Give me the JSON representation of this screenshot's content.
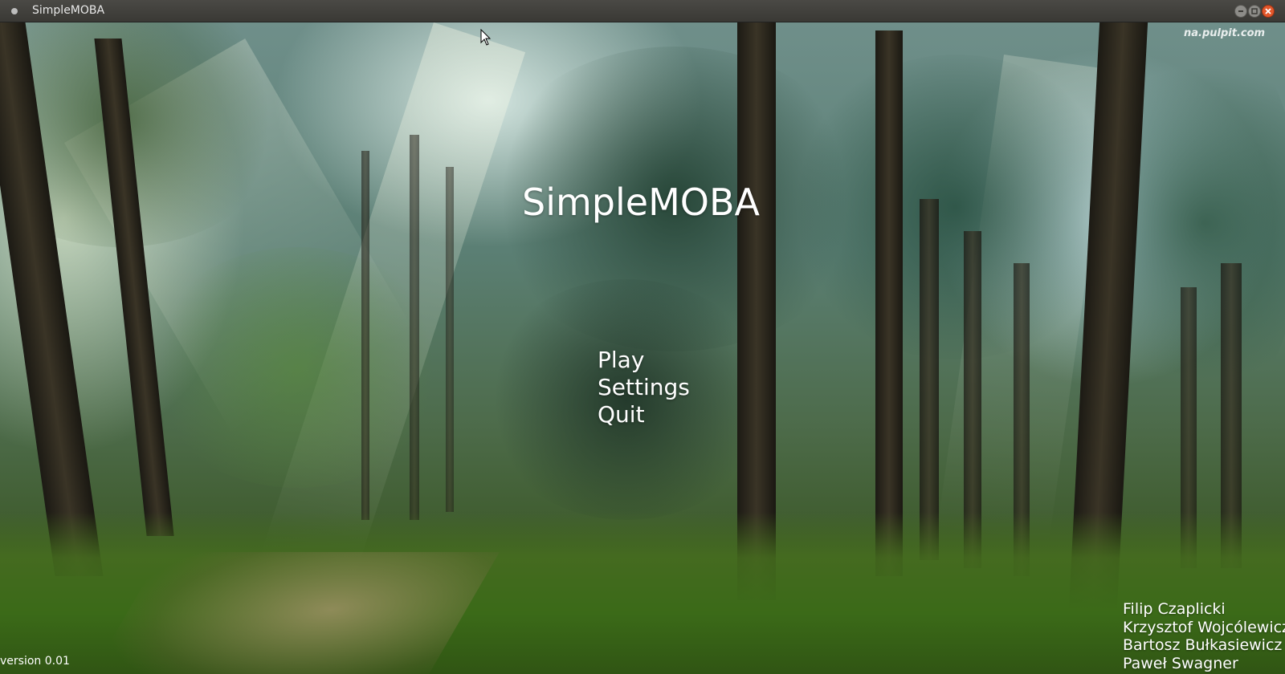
{
  "window": {
    "title": "SimpleMOBA",
    "controls": {
      "minimize_icon": "minimize-icon",
      "maximize_icon": "maximize-icon",
      "close_icon": "close-icon"
    }
  },
  "game": {
    "title": "SimpleMOBA",
    "menu": [
      {
        "label": "Play"
      },
      {
        "label": "Settings"
      },
      {
        "label": "Quit"
      }
    ],
    "version": "version 0.01",
    "credits": [
      "Filip Czaplicki",
      "Krzysztof Wojcólewicz",
      "Bartosz Bułkasiewicz",
      "Paweł Swagner"
    ],
    "watermark": "na.pulpit.com"
  },
  "colors": {
    "text": "#ffffff",
    "titlebar": "#3e3d39",
    "close_button": "#e2572b"
  }
}
